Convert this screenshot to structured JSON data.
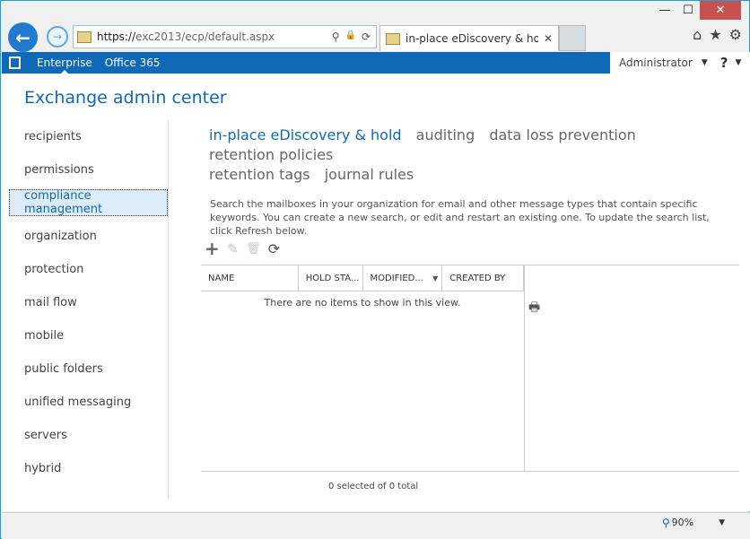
{
  "window": {
    "minimize": "—",
    "maximize": "☐",
    "close": "✕"
  },
  "browser": {
    "back": "←",
    "forward": "→",
    "url_prefix": "https://",
    "url_rest": "exc2013/ecp/default.aspx",
    "search_tool": "⚲",
    "lock_tool": "🔒",
    "refresh_tool": "⟳",
    "tab_label": "in-place eDiscovery & hold ...",
    "tab_close": "✕",
    "home": "⌂",
    "favorites": "★",
    "settings": "⚙"
  },
  "topbar": {
    "enterprise": "Enterprise",
    "office365": "Office 365",
    "user": "Administrator",
    "help": "?"
  },
  "app_title": "Exchange admin center",
  "sidebar": {
    "items": [
      {
        "label": "recipients"
      },
      {
        "label": "permissions"
      },
      {
        "label": "compliance management",
        "selected": true
      },
      {
        "label": "organization"
      },
      {
        "label": "protection"
      },
      {
        "label": "mail flow"
      },
      {
        "label": "mobile"
      },
      {
        "label": "public folders"
      },
      {
        "label": "unified messaging"
      },
      {
        "label": "servers"
      },
      {
        "label": "hybrid"
      }
    ]
  },
  "subtabs": [
    {
      "label": "in-place eDiscovery & hold",
      "active": true
    },
    {
      "label": "auditing"
    },
    {
      "label": "data loss prevention"
    },
    {
      "label": "retention policies"
    },
    {
      "label": "retention tags"
    },
    {
      "label": "journal rules"
    }
  ],
  "description": "Search the mailboxes in your organization for email and other message types that contain specific keywords. You can create a new search, or edit and restart an existing one. To update the search list, click Refresh below.",
  "toolbar": {
    "add": "+",
    "edit": "✎",
    "delete": "🗑",
    "refresh": "⟳"
  },
  "grid": {
    "columns": [
      "NAME",
      "HOLD STA...",
      "MODIFIED...",
      "CREATED BY"
    ],
    "empty_message": "There are no items to show in this view.",
    "count_text": "0 selected of 0 total"
  },
  "statusbar": {
    "zoom": "90%"
  },
  "colors": {
    "accent": "#1069b7",
    "selected_bg": "#dcecf8"
  }
}
